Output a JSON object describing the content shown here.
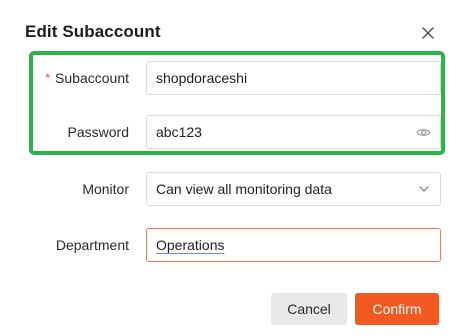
{
  "dialog": {
    "title": "Edit Subaccount",
    "close_icon": "close-icon"
  },
  "form": {
    "subaccount": {
      "label": "Subaccount",
      "required_mark": "*",
      "value": "shopdoraceshi"
    },
    "password": {
      "label": "Password",
      "value": "abc123",
      "icon": "eye-icon"
    },
    "monitor": {
      "label": "Monitor",
      "value": "Can view all monitoring data",
      "icon": "chevron-down-icon"
    },
    "department": {
      "label": "Department",
      "value": "Operations"
    }
  },
  "footer": {
    "cancel_label": "Cancel",
    "confirm_label": "Confirm"
  },
  "colors": {
    "accent": "#f25a22",
    "highlight": "#2db34a",
    "required": "#e0462e",
    "focus_border": "#f07a47"
  }
}
